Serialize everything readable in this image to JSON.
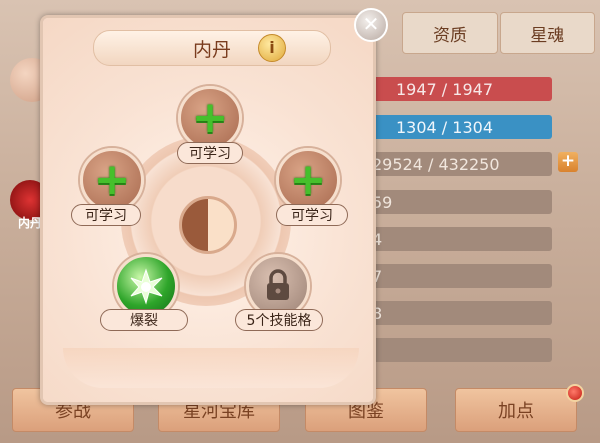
{
  "tabs": [
    "资质",
    "星魂"
  ],
  "stats": {
    "hp": "1947 / 1947",
    "mp": "1304 / 1304",
    "exp": "29524 / 432250",
    "rows": [
      "59",
      "4",
      "7",
      "8",
      ""
    ]
  },
  "bottom_buttons": [
    "参战",
    "星河宝库",
    "图鉴",
    "加点"
  ],
  "left_icon_label": "内丹",
  "dialog": {
    "title": "内丹",
    "info_icon": "i",
    "slots": [
      {
        "label": "可学习",
        "icon": "plus-icon"
      },
      {
        "label": "可学习",
        "icon": "plus-icon"
      },
      {
        "label": "可学习",
        "icon": "plus-icon"
      },
      {
        "label": "爆裂",
        "icon": "burst-skill-icon"
      },
      {
        "label": "5个技能格",
        "icon": "lock-icon"
      }
    ]
  },
  "colors": {
    "hp": "#c94d4e",
    "mp": "#3a91c4",
    "plus": "#46c02c"
  }
}
